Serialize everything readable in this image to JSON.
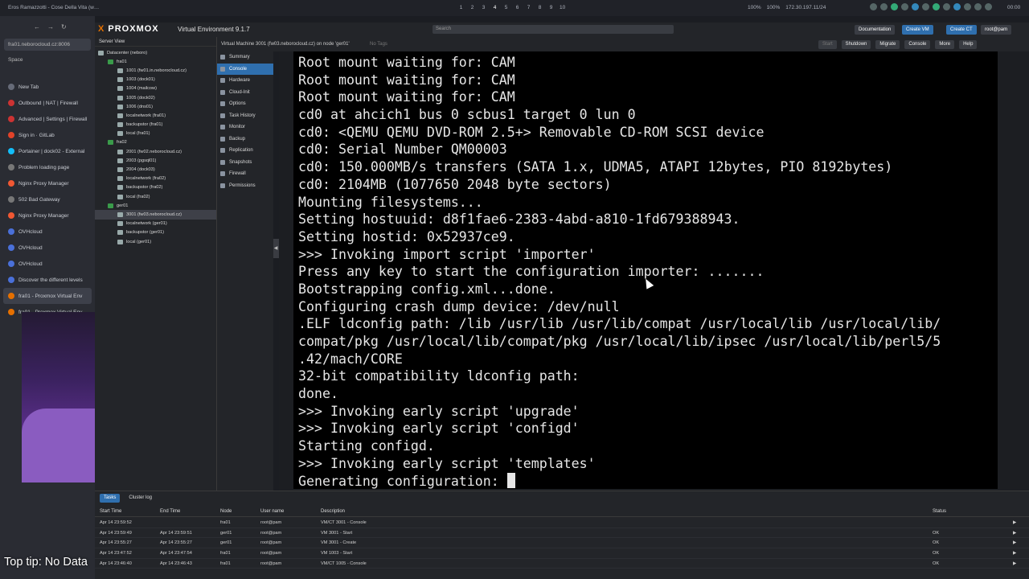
{
  "os": {
    "window_title": "Eros Ramazzotti - Cose Della Vita (w…",
    "workspaces": [
      "1",
      "2",
      "3",
      "4",
      "5",
      "6",
      "7",
      "8",
      "9",
      "10"
    ],
    "tray": [
      "100%",
      "100%",
      "172.30.197.11/24"
    ],
    "clock": "00:00"
  },
  "browser": {
    "url": "fra01.neborocloud.cz:8006",
    "space_label": "Space",
    "tabs": [
      {
        "label": "New Tab",
        "icon": "plus-icon",
        "color": "#666b78"
      },
      {
        "label": "Outbound | NAT | Firewall",
        "icon": "pfsense-icon",
        "color": "#c33"
      },
      {
        "label": "Advanced | Settings | Firewall",
        "icon": "pfsense-icon",
        "color": "#c33"
      },
      {
        "label": "Sign in · GitLab",
        "icon": "gitlab-icon",
        "color": "#e24329"
      },
      {
        "label": "Portainer | dock02 - External",
        "icon": "portainer-icon",
        "color": "#13bef9"
      },
      {
        "label": "Problem loading page",
        "icon": "page-icon",
        "color": "#777"
      },
      {
        "label": "Nginx Proxy Manager",
        "icon": "npm-icon",
        "color": "#f15833"
      },
      {
        "label": "502 Bad Gateway",
        "icon": "page-icon",
        "color": "#777"
      },
      {
        "label": "Nginx Proxy Manager",
        "icon": "npm-icon",
        "color": "#f15833"
      },
      {
        "label": "OVHcloud",
        "icon": "ovh-icon",
        "color": "#4a70d9"
      },
      {
        "label": "OVHcloud",
        "icon": "ovh-icon",
        "color": "#4a70d9"
      },
      {
        "label": "OVHcloud",
        "icon": "ovh-icon",
        "color": "#4a70d9"
      },
      {
        "label": "Discover the different levels",
        "icon": "ovh-icon",
        "color": "#4a70d9"
      },
      {
        "label": "fra01 - Proxmox Virtual Env",
        "icon": "proxmox-icon",
        "color": "#e57000",
        "active": true
      },
      {
        "label": "fra01 - Proxmox Virtual Env",
        "icon": "proxmox-icon",
        "color": "#e57000"
      }
    ]
  },
  "proxmox": {
    "brand": "PROXMOX",
    "version": "Virtual Environment 9.1.7",
    "search_placeholder": "Search",
    "buttons": {
      "documentation": "Documentation",
      "create_vm": "Create VM",
      "create_ct": "Create CT",
      "user": "root@pam"
    },
    "server_view": "Server View",
    "tree": [
      {
        "label": "Datacenter (neboro)",
        "level": 0
      },
      {
        "label": "fra01",
        "level": 1
      },
      {
        "label": "1001 (fw01.in.neborocloud.cz)",
        "level": 2
      },
      {
        "label": "1003 (dock01)",
        "level": 2
      },
      {
        "label": "1004 (mailcow)",
        "level": 2
      },
      {
        "label": "1005 (dock02)",
        "level": 2
      },
      {
        "label": "1006 (dns01)",
        "level": 2
      },
      {
        "label": "localnetwork (fra01)",
        "level": 2
      },
      {
        "label": "backupstor (fra01)",
        "level": 2
      },
      {
        "label": "local (fra01)",
        "level": 2
      },
      {
        "label": "fra02",
        "level": 1
      },
      {
        "label": "2001 (fw02.neborocloud.cz)",
        "level": 2
      },
      {
        "label": "2003 (pgsql01)",
        "level": 2
      },
      {
        "label": "2004 (dock03)",
        "level": 2
      },
      {
        "label": "localnetwork (fra02)",
        "level": 2
      },
      {
        "label": "backupstor (fra02)",
        "level": 2
      },
      {
        "label": "local (fra02)",
        "level": 2
      },
      {
        "label": "ger01",
        "level": 1
      },
      {
        "label": "3001 (fw03.neborocloud.cz)",
        "level": 2,
        "selected": true
      },
      {
        "label": "localnetwork (ger01)",
        "level": 2
      },
      {
        "label": "backupstor (ger01)",
        "level": 2
      },
      {
        "label": "local (ger01)",
        "level": 2
      }
    ],
    "vm_title": "Virtual Machine 3001 (fw03.neborocloud.cz) on node 'ger01'",
    "no_tags": "No Tags",
    "vm_buttons": [
      "Start",
      "Shutdown",
      "Migrate",
      "Console",
      "More",
      "Help"
    ],
    "vm_nav": [
      "Summary",
      "Console",
      "Hardware",
      "Cloud-Init",
      "Options",
      "Task History",
      "Monitor",
      "Backup",
      "Replication",
      "Snapshots",
      "Firewall",
      "Permissions"
    ],
    "console_lines": [
      "Root mount waiting for: CAM",
      "Root mount waiting for: CAM",
      "Root mount waiting for: CAM",
      "cd0 at ahcich1 bus 0 scbus1 target 0 lun 0",
      "cd0: <QEMU QEMU DVD-ROM 2.5+> Removable CD-ROM SCSI device",
      "cd0: Serial Number QM00003",
      "cd0: 150.000MB/s transfers (SATA 1.x, UDMA5, ATAPI 12bytes, PIO 8192bytes)",
      "cd0: 2104MB (1077650 2048 byte sectors)",
      "Mounting filesystems...",
      "Setting hostuuid: d8f1fae6-2383-4abd-a810-1fd679388943.",
      "Setting hostid: 0x52937ce9.",
      ">>> Invoking import script 'importer'",
      "Press any key to start the configuration importer: .......",
      "Bootstrapping config.xml...done.",
      "Configuring crash dump device: /dev/null",
      ".ELF ldconfig path: /lib /usr/lib /usr/lib/compat /usr/local/lib /usr/local/lib/",
      "compat/pkg /usr/local/lib/compat/pkg /usr/local/lib/ipsec /usr/local/lib/perl5/5",
      ".42/mach/CORE",
      "32-bit compatibility ldconfig path:",
      "done.",
      ">>> Invoking early script 'upgrade'",
      ">>> Invoking early script 'configd'",
      "Starting configd.",
      ">>> Invoking early script 'templates'",
      "Generating configuration: "
    ],
    "tasks": {
      "tabs": [
        "Tasks",
        "Cluster log"
      ],
      "headers": [
        "Start Time",
        "End Time",
        "Node",
        "User name",
        "Description",
        "Status"
      ],
      "rows": [
        [
          "Apr 14 23:59:52",
          "",
          "fra01",
          "root@pam",
          "VM/CT 3001 - Console",
          ""
        ],
        [
          "Apr 14 23:59:49",
          "Apr 14 23:59:51",
          "ger01",
          "root@pam",
          "VM 3001 - Start",
          "OK"
        ],
        [
          "Apr 14 23:55:27",
          "Apr 14 23:55:27",
          "ger01",
          "root@pam",
          "VM 3001 - Create",
          "OK"
        ],
        [
          "Apr 14 23:47:52",
          "Apr 14 23:47:54",
          "fra01",
          "root@pam",
          "VM 1003 - Start",
          "OK"
        ],
        [
          "Apr 14 23:46:40",
          "Apr 14 23:46:43",
          "fra01",
          "root@pam",
          "VM/CT 1005 - Console",
          "OK"
        ]
      ]
    }
  },
  "overlay": {
    "top_tip": "Top tip: No Data"
  }
}
